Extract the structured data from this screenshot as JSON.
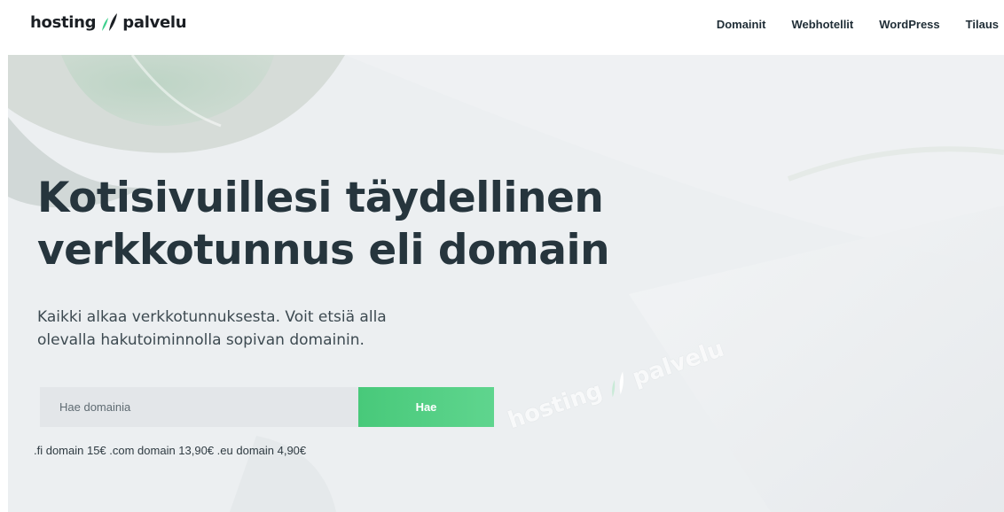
{
  "brand": {
    "word_left": "hosting",
    "word_right": "palvelu",
    "mark_icon": "leaf-drop-icon",
    "colors": {
      "mark_dark": "#1b1f24",
      "mark_green": "#3ecf8e",
      "accent": "#4fcd80"
    }
  },
  "nav": {
    "items": [
      "Domainit",
      "Webhotellit",
      "WordPress",
      "Tilaus"
    ]
  },
  "hero": {
    "headline_line1": "Kotisivuillesi täydellinen",
    "headline_line2": "verkkotunnus eli domain",
    "subtext_line1": "Kaikki alkaa verkkotunnuksesta. Voit etsiä alla",
    "subtext_line2": "olevalla hakutoiminnolla sopivan domainin.",
    "search": {
      "placeholder": "Hae domainia",
      "value": "",
      "button_label": "Hae"
    },
    "prices": ".fi domain 15€ .com domain 13,90€ .eu domain 4,90€",
    "watermark": {
      "word_left": "hosting",
      "word_right": "palvelu"
    }
  }
}
